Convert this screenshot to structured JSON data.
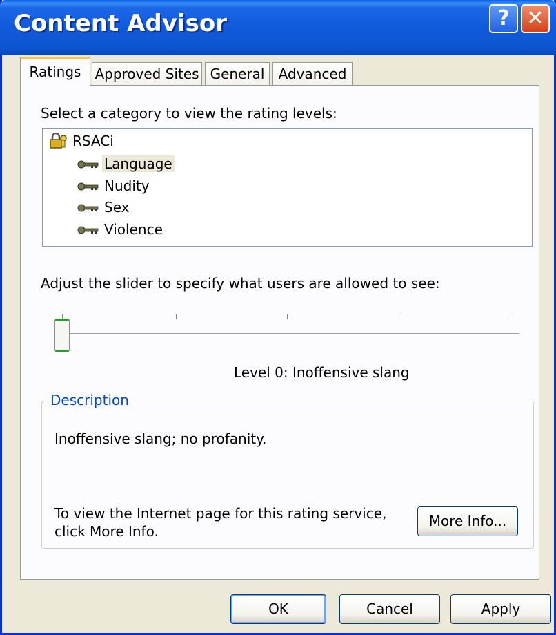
{
  "window": {
    "title": "Content Advisor"
  },
  "titlebar": {
    "help_label": "?",
    "close_label": "✕"
  },
  "tabs": [
    {
      "label": "Ratings"
    },
    {
      "label": "Approved Sites"
    },
    {
      "label": "General"
    },
    {
      "label": "Advanced"
    }
  ],
  "ratings": {
    "category_prompt": "Select a category to view the rating levels:",
    "tree": {
      "root": "RSACi",
      "items": [
        "Language",
        "Nudity",
        "Sex",
        "Violence"
      ],
      "selected": "Language"
    },
    "slider_prompt": "Adjust the slider to specify what users are allowed to see:",
    "slider": {
      "value": 0,
      "min": 0,
      "max": 4
    },
    "level_text": "Level 0:  Inoffensive slang",
    "description": {
      "legend": "Description",
      "text": "Inoffensive slang; no profanity.",
      "info_line1": "To view the Internet page for this rating service,",
      "info_line2": "click More Info.",
      "more_info_label": "More Info..."
    }
  },
  "buttons": {
    "ok_label": "OK",
    "cancel_label": "Cancel",
    "apply_label": "Apply"
  },
  "colors": {
    "titlebar": "#0F5BDB",
    "face": "#ECE9D8",
    "legend_text": "#0046D5",
    "selected_tab_accent": "#FFC83C"
  }
}
